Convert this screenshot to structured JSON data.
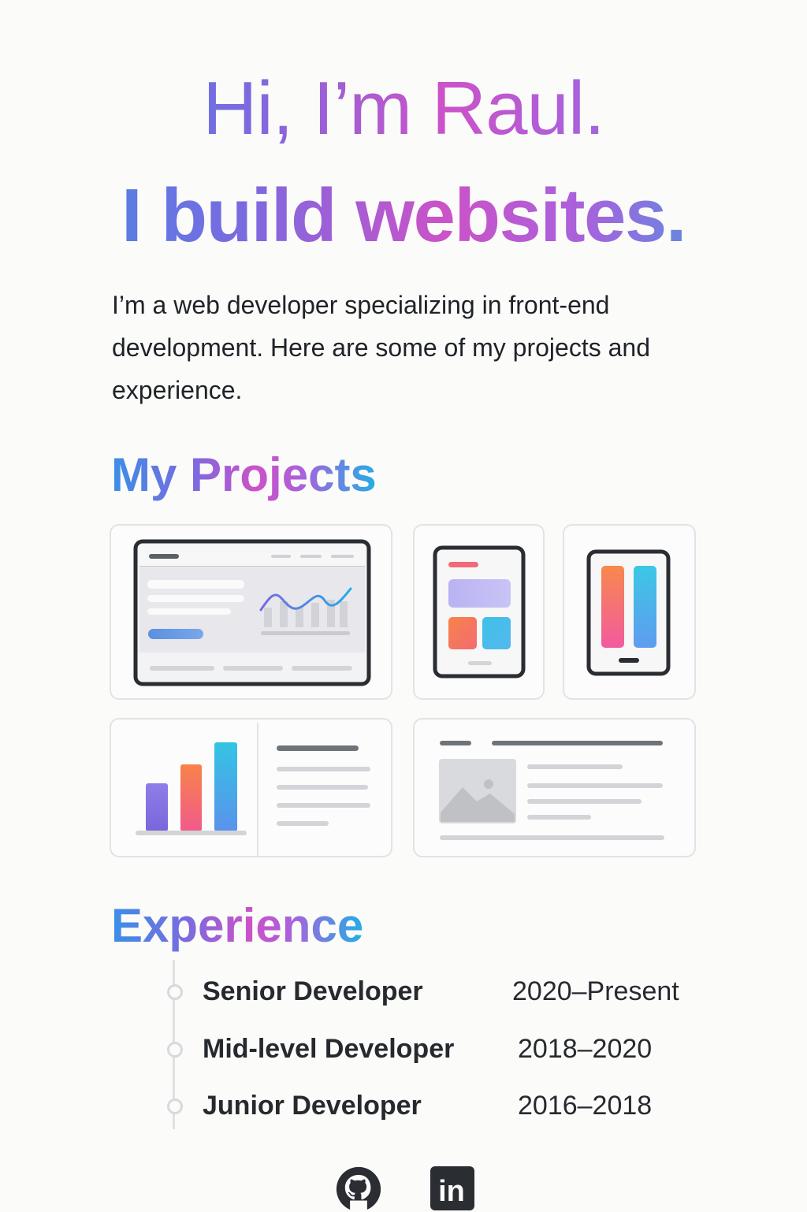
{
  "hero": {
    "line1": "Hi, I’m Raul.",
    "line2": "I build websites."
  },
  "intro": "I’m a web developer specializing in front-end development. Here are some of my projects and experience.",
  "projects": {
    "title": "My Projects",
    "cards": [
      {
        "icon": "desktop-dashboard-illustration"
      },
      {
        "icon": "tablet-app-illustration"
      },
      {
        "icon": "mobile-app-illustration"
      },
      {
        "icon": "bar-chart-report-illustration"
      },
      {
        "icon": "blog-article-illustration"
      }
    ]
  },
  "experience": {
    "title": "Experience",
    "items": [
      {
        "role": "Senior Developer",
        "dates": "2020–Present"
      },
      {
        "role": "Mid-level Developer",
        "dates": "2018–2020"
      },
      {
        "role": "Junior Developer",
        "dates": "2016–2018"
      }
    ]
  },
  "social": {
    "github_icon": "github-icon",
    "linkedin_icon": "linkedin-icon",
    "linkedin_label": "in"
  },
  "colors": {
    "background": "#fbfbf9",
    "gradient": [
      "#3b8fe6",
      "#7a6ae0",
      "#cc52c8",
      "#22aee6"
    ],
    "text": "#22262b",
    "card_border": "#e2e3e6"
  }
}
